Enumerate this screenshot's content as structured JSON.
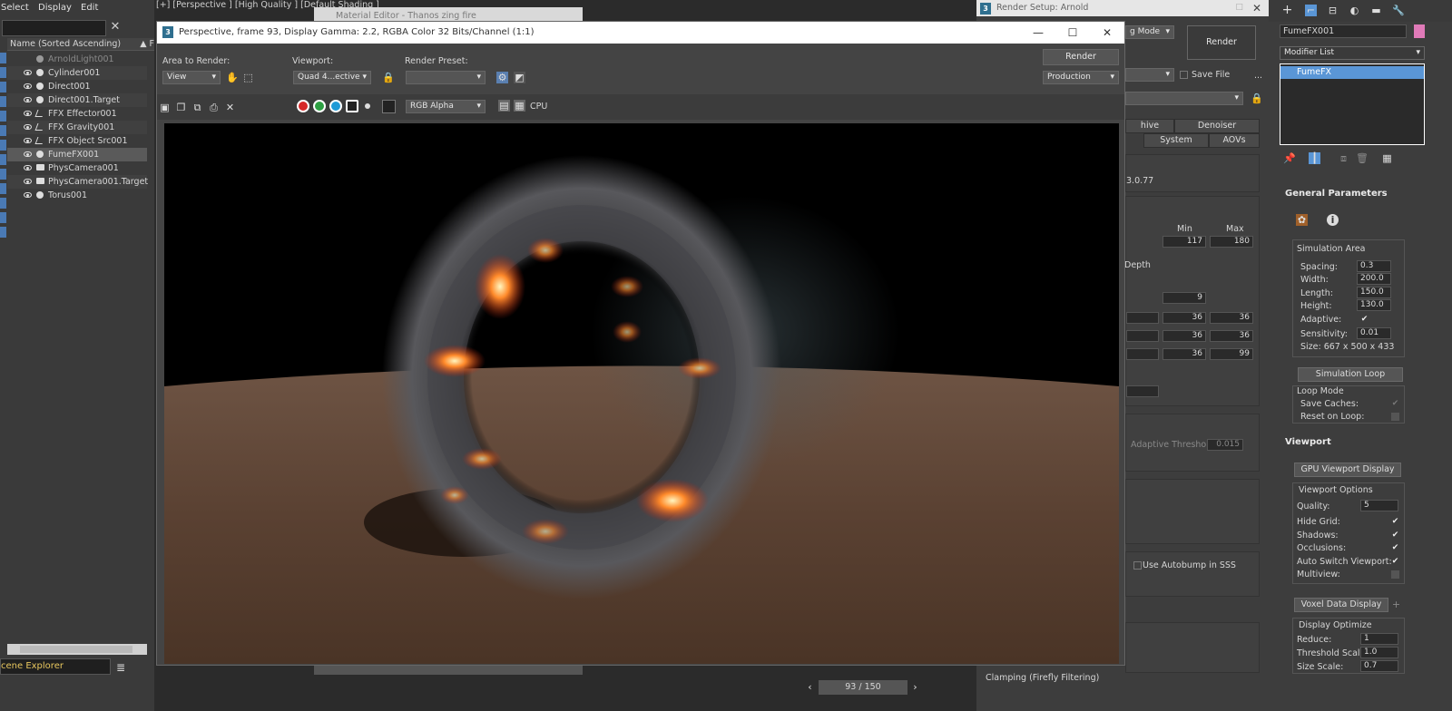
{
  "menubar": {
    "select": "Select",
    "display": "Display",
    "edit": "Edit"
  },
  "viewport_label": "[+] [Perspective ] [High Quality ] [Default Shading ]",
  "explorer": {
    "header": "Name (Sorted Ascending)",
    "header_right": "▲ F",
    "items": [
      {
        "name": "ArnoldLight001"
      },
      {
        "name": "Cylinder001"
      },
      {
        "name": "Direct001"
      },
      {
        "name": "Direct001.Target"
      },
      {
        "name": "FFX Effector001"
      },
      {
        "name": "FFX Gravity001"
      },
      {
        "name": "FFX Object Src001"
      },
      {
        "name": "FumeFX001"
      },
      {
        "name": "PhysCamera001"
      },
      {
        "name": "PhysCamera001.Target"
      },
      {
        "name": "Torus001"
      }
    ],
    "footer": "cene Explorer"
  },
  "bg_windows": {
    "material_editor": "Material Editor - Thanos zing fire",
    "render_setup": "Render Setup: Arnold"
  },
  "frame": {
    "title": "Perspective, frame 93, Display Gamma: 2.2, RGBA Color 32 Bits/Channel (1:1)",
    "area_label": "Area to Render:",
    "area_value": "View",
    "viewport_label": "Viewport:",
    "viewport_value": "Quad 4...ective",
    "preset_label": "Render Preset:",
    "preset_value": "",
    "render_button": "Render",
    "production_value": "Production",
    "channel_value": "RGB Alpha",
    "cpu_label": "CPU"
  },
  "render_setup": {
    "mode_value": "g Mode",
    "render_button": "Render",
    "save_file": "Save File",
    "more": "...",
    "tabs": {
      "archive": "hive",
      "denoiser": "Denoiser",
      "system": "System",
      "aovs": "AOVs"
    },
    "version": "3.0.77",
    "min_label": "Min",
    "max_label": "Max",
    "min_value": "117",
    "max_value": "180",
    "depth_label": "Depth",
    "field_9": "9",
    "rows": [
      {
        "a": "36",
        "b": "36"
      },
      {
        "a": "36",
        "b": "36"
      },
      {
        "a": "36",
        "b": "99"
      }
    ],
    "adaptive_threshold_label": "Adaptive Threshold:",
    "adaptive_threshold_value": "0.015",
    "autobump": "Use Autobump in SSS",
    "clamping": "Clamping (Firefly Filtering)"
  },
  "command_panel": {
    "object_name": "FumeFX001",
    "modifier_list": "Modifier List",
    "stack_item": "FumeFX",
    "general_parameters": "General Parameters",
    "simulation_area": "Simulation Area",
    "spacing_label": "Spacing:",
    "spacing": "0.3",
    "width_label": "Width:",
    "width": "200.0",
    "length_label": "Length:",
    "length": "150.0",
    "height_label": "Height:",
    "height": "130.0",
    "adaptive_label": "Adaptive:",
    "sensitivity_label": "Sensitivity:",
    "sensitivity": "0.01",
    "size_text": "Size: 667 x 500 x 433",
    "simulation_loop": "Simulation Loop",
    "loop_mode": "Loop Mode",
    "save_caches": "Save Caches:",
    "reset_on_loop": "Reset on Loop:",
    "viewport_title": "Viewport",
    "gpu_viewport_display": "GPU Viewport Display",
    "viewport_options": "Viewport Options",
    "quality_label": "Quality:",
    "quality": "5",
    "hide_grid": "Hide Grid:",
    "shadows": "Shadows:",
    "occlusions": "Occlusions:",
    "auto_switch": "Auto Switch Viewport:",
    "multiview": "Multiview:",
    "voxel_data_display": "Voxel Data Display",
    "display_optimize": "Display Optimize",
    "reduce_label": "Reduce:",
    "reduce": "1",
    "threshold_scale_label": "Threshold Scale:",
    "threshold_scale": "1.0",
    "size_scale_label": "Size Scale:",
    "size_scale": "0.7"
  },
  "timeline": {
    "frame": "93 / 150"
  },
  "colors": {
    "accent": "#4a7ab5",
    "selection": "#5a96d6",
    "pink": "#e07ab8"
  }
}
